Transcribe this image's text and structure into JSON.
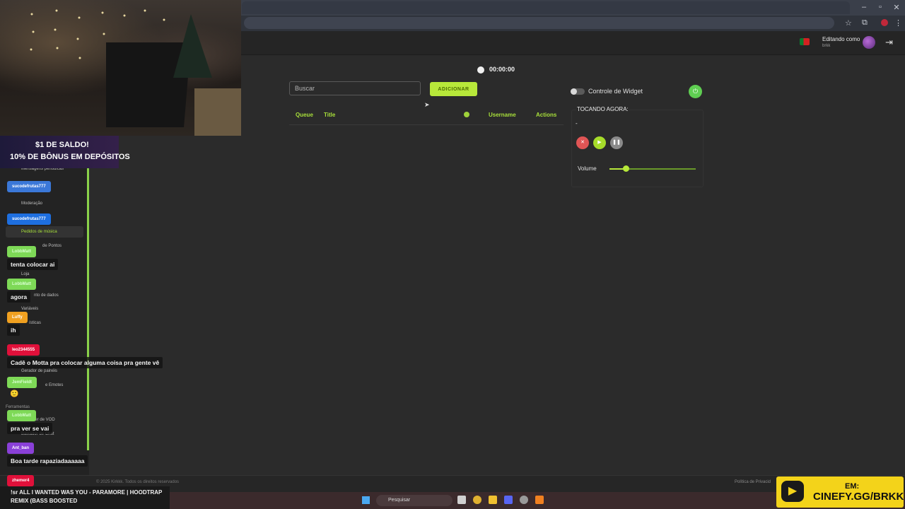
{
  "header": {
    "editing_label": "Editando como",
    "editing_user": "brkk",
    "logout_icon": "logout-icon"
  },
  "player": {
    "timer": "00:00:00",
    "search_placeholder": "Buscar",
    "add_button": "ADICIONAR",
    "columns": {
      "queue": "Queue",
      "title": "Title",
      "username": "Username",
      "actions": "Actions"
    },
    "widget_control_label": "Controle de Widget",
    "now_playing_title": "TOCANDO AGORA:",
    "now_playing_track": "-",
    "volume_label": "Volume",
    "volume_level": 0.2,
    "accent": "#b7e83a"
  },
  "footer": {
    "left": "© 2025 Kirkkk. Todos os direitos reservados",
    "right": "Política de Privacid"
  },
  "sidebar": {
    "items": [
      "Mensagens periódicas",
      "Moderação",
      "Pedidos de música",
      "de Pontos",
      "Loja",
      "nto de dados",
      "Variáveis",
      "ísticas",
      "Gerador de painéis",
      "e Emotes",
      "Ferramentas",
      "der de VOD",
      "Baixador de Chat"
    ]
  },
  "chat": [
    {
      "name": "sucodefrutas777",
      "message": "",
      "color": "#3b78d8"
    },
    {
      "name": "sucodefrutas777",
      "message": "",
      "color": "#3b78d8"
    },
    {
      "name": "LobbMatt",
      "message": "tenta colocar ai",
      "color": "#7ed957"
    },
    {
      "name": "LobbMatt",
      "message": "agora",
      "color": "#7ed957"
    },
    {
      "name": "Luffy",
      "message": "ih",
      "color": "#f0a020"
    },
    {
      "name": "leo2344555",
      "message": "Cadê o Motta pra colocar alguma coisa pra gente vê",
      "color": "#e0103a"
    },
    {
      "name": "JemFieldt",
      "message": "",
      "color": "#7ed957"
    },
    {
      "name": "LobbMatt",
      "message": "pra ver se vai",
      "color": "#7ed957"
    },
    {
      "name": "Ant_ban",
      "message": "Boa tarde rapaziadaaaaaa",
      "color": "#8a40d8"
    },
    {
      "name": "zhemer4",
      "message": "",
      "color": "#e0103a"
    }
  ],
  "now_playing_overlay": "!sr ALL I WANTED WAS YOU - PARAMORE | HOODTRAP REMIX (BASS BOOSTED",
  "promo": {
    "line1": "$1 DE SALDO!",
    "line2": "10% DE BÔNUS EM DEPÓSITOS"
  },
  "taskbar": {
    "search_label": "Pesquisar"
  },
  "cinefy": {
    "em": "EM:",
    "url": "CINEFY.GG/BRKK"
  }
}
